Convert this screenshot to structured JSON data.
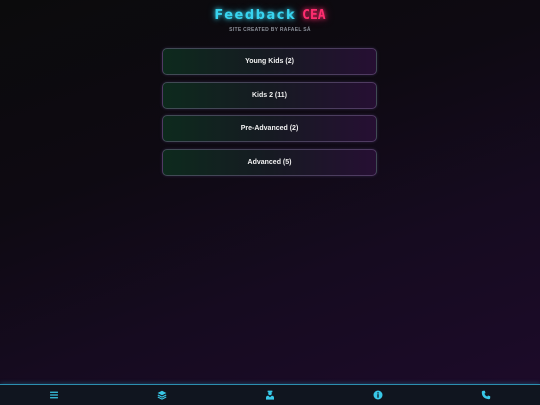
{
  "header": {
    "title": "Feedback",
    "logo_text": "CEA",
    "subtitle": "SITE CREATED BY RAFAEL SÁ"
  },
  "groups": [
    {
      "label": "Young Kids (2)"
    },
    {
      "label": "Kids 2 (11)"
    },
    {
      "label": "Pre-Advanced (2)"
    },
    {
      "label": "Advanced (5)"
    }
  ],
  "navbar": {
    "icons": [
      "menu-icon",
      "layers-icon",
      "teacher-icon",
      "info-icon",
      "phone-icon"
    ]
  },
  "colors": {
    "title": "#38d4ef",
    "logo": "#ff2d6f",
    "nav_icon": "#38c8e8",
    "nav_border": "#2c8fb0"
  }
}
